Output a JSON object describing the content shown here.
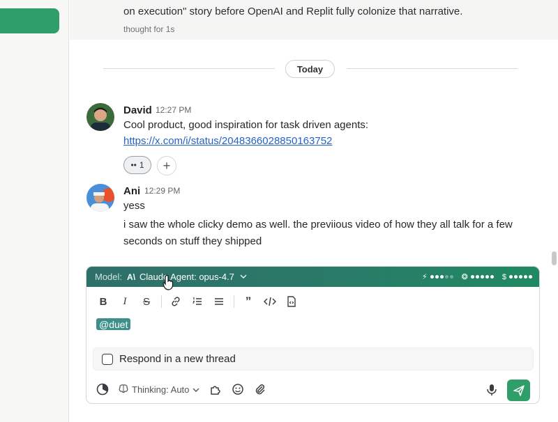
{
  "previous_message": {
    "text": "on execution\" story before OpenAI and Replit fully colonize that narrative.",
    "thought": "thought for 1s"
  },
  "date_divider": "Today",
  "messages": [
    {
      "author": "David",
      "time": "12:27 PM",
      "text": "Cool product, good inspiration for task driven agents:",
      "link": "https://x.com/i/status/2048366028850163752",
      "reaction_emoji": "••",
      "reaction_count": "1",
      "add_reaction": "+"
    },
    {
      "author": "Ani",
      "time": "12:29 PM",
      "line1": "yess",
      "line2": "i saw the whole clicky demo as well. the previious video of how they all talk for a few",
      "line3": "seconds on stuff they shipped"
    }
  ],
  "composer": {
    "model_label": "Model:",
    "model_icon": "A\\",
    "model_value": "Claude Agent: opus-4.7",
    "stats": [
      {
        "icon": "bolt-icon",
        "glyph": "⚡",
        "filled": 3,
        "total": 5
      },
      {
        "icon": "openai-icon",
        "glyph": "❂",
        "filled": 5,
        "total": 5
      },
      {
        "icon": "dollar-icon",
        "glyph": "$",
        "filled": 5,
        "total": 5
      }
    ],
    "mention": "@duet",
    "respond_label": "Respond in a new thread",
    "thinking_label": "Thinking: Auto"
  },
  "colors": {
    "accent": "#2f9e69",
    "link": "#2563c9",
    "mention_bg": "#3d8f8a"
  }
}
